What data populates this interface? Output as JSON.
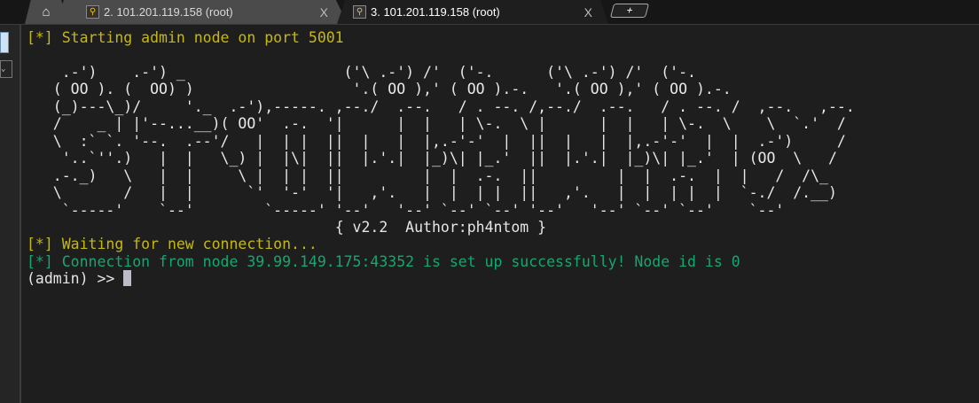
{
  "tabs": [
    {
      "icon": "home-icon"
    },
    {
      "label": "2. 101.201.119.158 (root)",
      "icon": "key-icon",
      "close": "X"
    },
    {
      "label": "3. 101.201.119.158 (root)",
      "icon": "key-icon",
      "close": "X",
      "active": true
    }
  ],
  "new_tab_label": "+",
  "terminal": {
    "start_line": "[*] Starting admin node on port 5001",
    "banner": [
      "    .-')    .-') _                  ('\\ .-') /'  ('-.      ('\\ .-') /'  ('-.",
      "   ( OO ). (  OO) )                  '.( OO ),' ( OO ).-.   '.( OO ),' ( OO ).-.",
      "   (_)---\\_)/     '._  .-'),-----. ,--./  .--.   / . --. /,--./  .--.   / . --. /  ,--.   ,--.",
      "   /    _ | |'--...__)( OO'  .-.  '|      |  |   | \\-.  \\ |      |  |   | \\-.  \\    \\  `.'  /",
      "   \\  :` `. '--.  .--'/   |  | |  ||  |   |  |,.-'-'  |  ||  |   |  |,.-'-'  |  |  .-')     /",
      "    '..`''.)   |  |   \\_) |  |\\|  ||  |.'.|  |_)\\| |_.'  ||  |.'.|  |_)\\| |_.'  | (OO  \\   /",
      "   .-._)   \\   |  |     \\ |  | |  ||         |  |  .-.  ||         |  |  .-.  |  |   /  /\\_",
      "   \\       /   |  |      `'  '-'  '|   ,'.   |  |  | |  ||   ,'.   |  |  | |  |  `-./  /.__)",
      "    `-----'    `--'        `-----' '--'   '--' `--' `--' '--'   '--' `--' `--'    `--'"
    ],
    "version_line": "{ v2.2  Author:ph4ntom }",
    "waiting_line": "[*] Waiting for new connection...",
    "connection_line": "[*] Connection from node 39.99.149.175:43352 is set up successfully! Node id is 0",
    "prompt": "(admin) >> "
  },
  "colors": {
    "info": "#c6b812",
    "success": "#13a870",
    "background": "#1e1e1e"
  }
}
